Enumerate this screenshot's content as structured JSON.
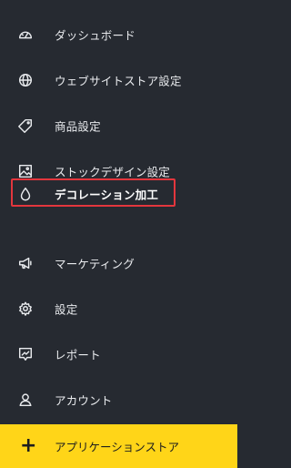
{
  "sidebar": {
    "items": [
      {
        "label": "ダッシュボード",
        "icon": "dashboard-gauge-icon"
      },
      {
        "label": "ウェブサイトストア設定",
        "icon": "globe-icon"
      },
      {
        "label": "商品設定",
        "icon": "tag-icon"
      },
      {
        "label": "ストックデザイン設定",
        "icon": "image-icon"
      },
      {
        "label": "デコレーション加工",
        "icon": "droplet-icon",
        "active": true
      },
      {
        "label": "マーケティング",
        "icon": "megaphone-icon"
      },
      {
        "label": "設定",
        "icon": "gear-icon"
      },
      {
        "label": "レポート",
        "icon": "report-icon"
      },
      {
        "label": "アカウント",
        "icon": "user-icon"
      }
    ],
    "app_store": {
      "label": "アプリケーションストア",
      "icon": "plus-icon"
    }
  },
  "colors": {
    "background": "#262a31",
    "text": "#e9ebee",
    "highlight_border": "#e3363d",
    "app_store_bg": "#ffd518"
  }
}
